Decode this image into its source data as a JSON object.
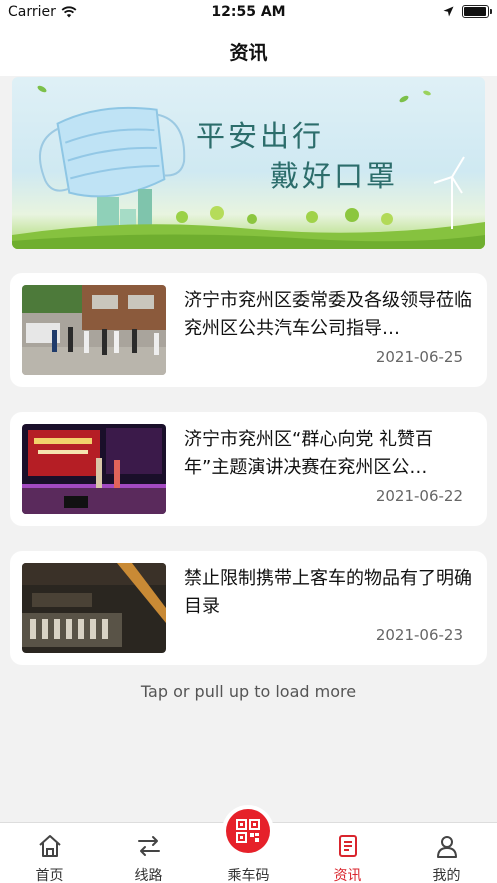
{
  "status_bar": {
    "carrier": "Carrier",
    "time": "12:55 AM",
    "battery_level": 0.95
  },
  "nav": {
    "title": "资讯"
  },
  "banner": {
    "line1": "平安出行",
    "line2": "戴好口罩"
  },
  "news": [
    {
      "title": "济宁市兖州区委常委及各级领导莅临兖州区公共汽车公司指导…",
      "date": "2021-06-25"
    },
    {
      "title": "济宁市兖州区“群心向党 礼赞百年”主题演讲决赛在兖州区公…",
      "date": "2021-06-22"
    },
    {
      "title": "禁止限制携带上客车的物品有了明确目录",
      "date": "2021-06-23"
    }
  ],
  "load_more": "Tap or pull up to load more",
  "tabs": [
    {
      "label": "首页",
      "icon": "home-icon"
    },
    {
      "label": "线路",
      "icon": "route-icon"
    },
    {
      "label": "乘车码",
      "icon": "qr-code-icon"
    },
    {
      "label": "资讯",
      "icon": "news-icon",
      "active": true
    },
    {
      "label": "我的",
      "icon": "profile-icon"
    }
  ],
  "colors": {
    "accent": "#d9252d"
  }
}
